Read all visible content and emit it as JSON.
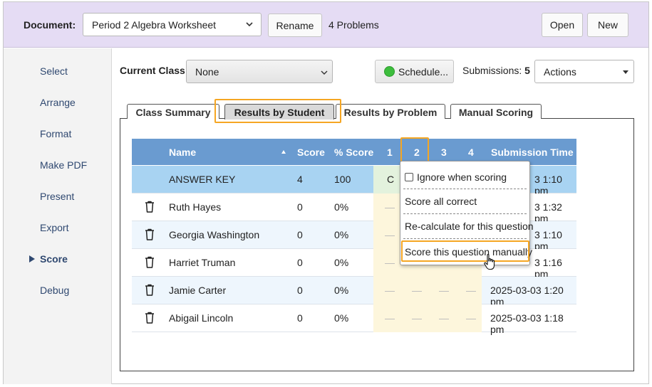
{
  "toolbar": {
    "document_label": "Document:",
    "document_value": "Period 2 Algebra Worksheet",
    "rename": "Rename",
    "problems": "4 Problems",
    "open": "Open",
    "new": "New"
  },
  "sidebar": {
    "items": [
      "Select",
      "Arrange",
      "Format",
      "Make PDF",
      "Present",
      "Export",
      "Score",
      "Debug"
    ],
    "active": "Score"
  },
  "classbar": {
    "label": "Current Class:",
    "value": "None",
    "schedule": "Schedule...",
    "submissions_label": "Submissions:",
    "submissions_count": "5",
    "actions": "Actions"
  },
  "tabs": [
    "Class Summary",
    "Results by Student",
    "Results by Problem",
    "Manual Scoring"
  ],
  "active_tab": "Results by Student",
  "table": {
    "headers": [
      "Name",
      "Score",
      "% Score",
      "1",
      "2",
      "3",
      "4",
      "Submission Time"
    ],
    "rows": [
      {
        "name": "ANSWER KEY",
        "score": "4",
        "pct": "100",
        "q1": "C",
        "time": "3 1:10 pm",
        "key": true
      },
      {
        "name": "Ruth Hayes",
        "score": "0",
        "pct": "0%",
        "q1": "—",
        "time": "3 1:32 pm"
      },
      {
        "name": "Georgia Washington",
        "score": "0",
        "pct": "0%",
        "q1": "—",
        "time": "3 1:10 pm"
      },
      {
        "name": "Harriet Truman",
        "score": "0",
        "pct": "0%",
        "q1": "—",
        "time": "3 1:16 pm"
      },
      {
        "name": "Jamie Carter",
        "score": "0",
        "pct": "0%",
        "q1": "—",
        "q2": "—",
        "q3": "—",
        "q4": "—",
        "time": "2025-03-03 1:20 pm"
      },
      {
        "name": "Abigail Lincoln",
        "score": "0",
        "pct": "0%",
        "q1": "—",
        "q2": "—",
        "q3": "—",
        "q4": "—",
        "time": "2025-03-03 1:18 pm"
      }
    ]
  },
  "menu": {
    "ignore": "Ignore when scoring",
    "score_all": "Score all correct",
    "recalc": "Re-calculate for this question",
    "manual": "Score this question manually"
  },
  "colors": {
    "topbar": "#e5dcf4",
    "header": "#6a9bd0",
    "answer_key_row": "#a8d3f2",
    "highlight": "#f5a623"
  }
}
